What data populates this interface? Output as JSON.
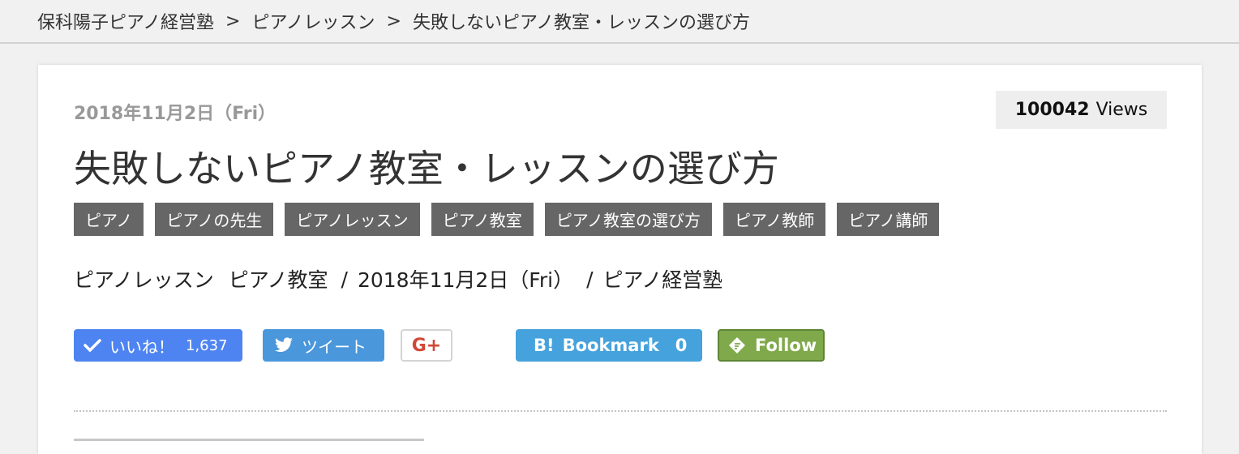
{
  "breadcrumb": {
    "items": [
      "保科陽子ピアノ経営塾",
      "ピアノレッスン",
      "失敗しないピアノ教室・レッスンの選び方"
    ],
    "separator": ">"
  },
  "article": {
    "date": "2018年11月2日（Fri）",
    "views_count": "100042",
    "views_label": "Views",
    "title": "失敗しないピアノ教室・レッスンの選び方",
    "tags": [
      "ピアノ",
      "ピアノの先生",
      "ピアノレッスン",
      "ピアノ教室",
      "ピアノ教室の選び方",
      "ピアノ教師",
      "ピアノ講師"
    ],
    "meta": {
      "categories": [
        "ピアノレッスン",
        "ピアノ教室"
      ],
      "date": "2018年11月2日（Fri）",
      "author": "ピアノ経営塾",
      "separator": "/"
    }
  },
  "social": {
    "like_label": "いいね！",
    "like_count": "1,637",
    "tweet_label": "ツイート",
    "gplus_label": "G+",
    "bookmark_label": "Bookmark",
    "bookmark_count": "0",
    "hatena_logo": "B!",
    "follow_label": "Follow",
    "colors": {
      "like": "#4e84f1",
      "tweet": "#4a97dc",
      "gplus": "#d04836",
      "bookmark": "#46a2dc",
      "follow": "#7fa94a"
    }
  }
}
